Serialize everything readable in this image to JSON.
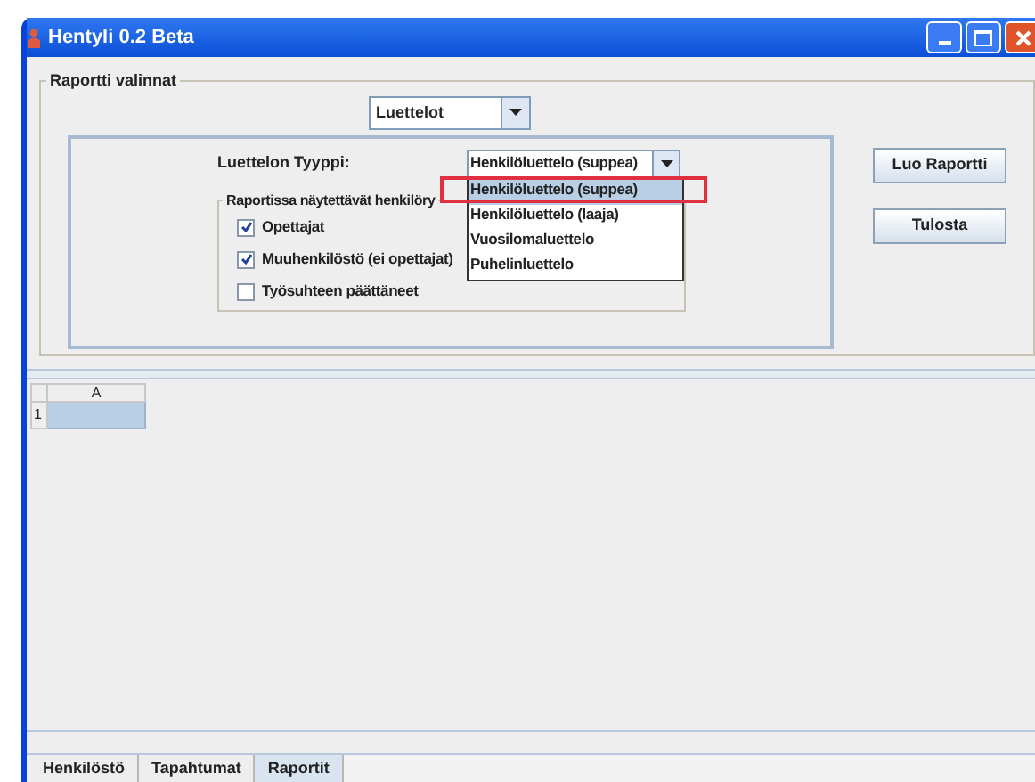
{
  "window": {
    "title": "Hentyli 0.2 Beta"
  },
  "report_options": {
    "title": "Raportti valinnat",
    "report_type": {
      "value": "Luettelot"
    },
    "list_type": {
      "label": "Luettelon Tyyppi:",
      "value": "Henkilöluettelo (suppea)",
      "expanded": true,
      "options": [
        {
          "label": "Henkilöluettelo (suppea)",
          "selected": true,
          "annotated": true
        },
        {
          "label": "Henkilöluettelo (laaja)",
          "selected": false,
          "annotated": false
        },
        {
          "label": "Vuosilomaluettelo",
          "selected": false,
          "annotated": false
        },
        {
          "label": "Puhelinluettelo",
          "selected": false,
          "annotated": false
        }
      ]
    },
    "groups": {
      "title": "Raportissa näytettävät henkilöry",
      "items": [
        {
          "label": "Opettajat",
          "checked": true
        },
        {
          "label": "Muuhenkilöstö (ei opettajat)",
          "checked": true
        },
        {
          "label": "Työsuhteen päättäneet",
          "checked": false
        }
      ]
    }
  },
  "buttons": [
    "Luo Raportti",
    "Tulosta"
  ],
  "sheet": {
    "columns": [
      "A"
    ],
    "rows": [
      {
        "number": "1",
        "selected": true
      }
    ]
  },
  "tabs": [
    {
      "label": "Henkilöstö",
      "selected": false
    },
    {
      "label": "Tapahtumat",
      "selected": false
    },
    {
      "label": "Raportit",
      "selected": true
    }
  ]
}
